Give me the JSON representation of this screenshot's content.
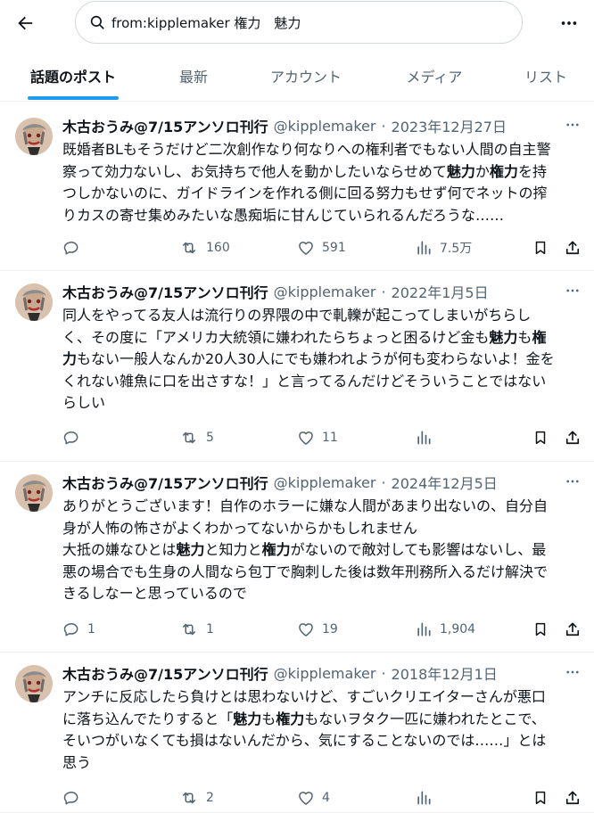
{
  "search": {
    "query": "from:kipplemaker 権力　魅力"
  },
  "tabs": [
    "話題のポスト",
    "最新",
    "アカウント",
    "メディア",
    "リスト"
  ],
  "author": {
    "name": "木古おうみ@7/15アンソロ刊行",
    "handle": "@kipplemaker"
  },
  "posts": [
    {
      "date": "2023年12月27日",
      "lines": [
        [
          {
            "t": "既婚者BLもそうだけど二次創作なり何なりへの権利者でもない人間の自主警"
          }
        ],
        [
          {
            "t": "察って効力ないし、お気持ちで他人を動かしたいならせめて"
          },
          {
            "t": "魅力",
            "b": true
          },
          {
            "t": "か"
          },
          {
            "t": "権力",
            "b": true
          },
          {
            "t": "を持"
          }
        ],
        [
          {
            "t": "つしかないのに、ガイドラインを作れる側に回る努力もせず何でネットの搾"
          }
        ],
        [
          {
            "t": "りカスの寄せ集めみたいな愚痴垢に甘んじていられるんだろうな……"
          }
        ]
      ],
      "replies": "",
      "reposts": "160",
      "likes": "591",
      "views": "7.5万"
    },
    {
      "date": "2022年1月5日",
      "lines": [
        [
          {
            "t": "同人をやってる友人は流行りの界隈の中で軋轢が起こってしまいがちらし"
          }
        ],
        [
          {
            "t": "く、その度に「アメリカ大統領に嫌われたらちょっと困るけど金も"
          },
          {
            "t": "魅力",
            "b": true
          },
          {
            "t": "も"
          },
          {
            "t": "権",
            "b": true
          }
        ],
        [
          {
            "t": "力",
            "b": true
          },
          {
            "t": "もない一般人なんか20人30人にでも嫌われようが何も変わらないよ！金を"
          }
        ],
        [
          {
            "t": "くれない雑魚に口を出さすな！」と言ってるんだけどそういうことではない"
          }
        ],
        [
          {
            "t": "らしい"
          }
        ]
      ],
      "replies": "",
      "reposts": "5",
      "likes": "11",
      "views": ""
    },
    {
      "date": "2024年12月5日",
      "lines": [
        [
          {
            "t": "ありがとうございます！自作のホラーに嫌な人間があまり出ないの、自分自"
          }
        ],
        [
          {
            "t": "身が人怖の怖さがよくわかってないからかもしれません"
          }
        ],
        [
          {
            "t": "大抵の嫌なひとは"
          },
          {
            "t": "魅力",
            "b": true
          },
          {
            "t": "と知力と"
          },
          {
            "t": "権力",
            "b": true
          },
          {
            "t": "がないので敵対しても影響はないし、最"
          }
        ],
        [
          {
            "t": "悪の場合でも生身の人間なら包丁で胸刺した後は数年刑務所入るだけ解決で"
          }
        ],
        [
          {
            "t": "きるしなーと思っているので"
          }
        ]
      ],
      "replies": "1",
      "reposts": "1",
      "likes": "19",
      "views": "1,904"
    },
    {
      "date": "2018年12月1日",
      "lines": [
        [
          {
            "t": "アンチに反応したら負けとは思わないけど、すごいクリエイターさんが悪口"
          }
        ],
        [
          {
            "t": "に落ち込んでたりすると「"
          },
          {
            "t": "魅力",
            "b": true
          },
          {
            "t": "も"
          },
          {
            "t": "権力",
            "b": true
          },
          {
            "t": "もないヲタク一匹に嫌われたとこで、"
          }
        ],
        [
          {
            "t": "そいつがいなくても損はないんだから、気にすることないのでは……」とは"
          }
        ],
        [
          {
            "t": "思う"
          }
        ]
      ],
      "replies": "",
      "reposts": "2",
      "likes": "4",
      "views": ""
    }
  ]
}
